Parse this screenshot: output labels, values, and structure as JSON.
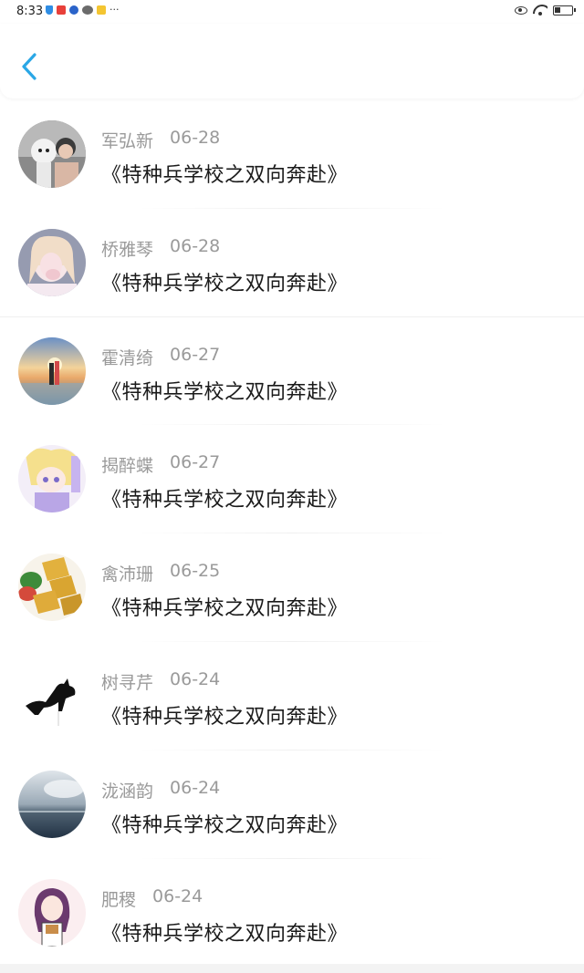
{
  "status_bar": {
    "time": "8:33",
    "more": "···"
  },
  "header": {
    "back_icon": "chevron-left-icon",
    "accent_color": "#2aa7e6"
  },
  "list": [
    {
      "name": "军弘新",
      "date": "06-28",
      "title": "《特种兵学校之双向奔赴》",
      "avatar": "avatar-robot-couple"
    },
    {
      "name": "桥雅琴",
      "date": "06-28",
      "title": "《特种兵学校之双向奔赴》",
      "avatar": "avatar-girl-selfie"
    },
    {
      "name": "霍清绮",
      "date": "06-27",
      "title": "《特种兵学校之双向奔赴》",
      "avatar": "avatar-beach-sunset"
    },
    {
      "name": "揭醉蝶",
      "date": "06-27",
      "title": "《特种兵学校之双向奔赴》",
      "avatar": "avatar-anime-girl"
    },
    {
      "name": "禽沛珊",
      "date": "06-25",
      "title": "《特种兵学校之双向奔赴》",
      "avatar": "avatar-cake-cubes"
    },
    {
      "name": "树寻芹",
      "date": "06-24",
      "title": "《特种兵学校之双向奔赴》",
      "avatar": "avatar-black-cat"
    },
    {
      "name": "泷涵韵",
      "date": "06-24",
      "title": "《特种兵学校之双向奔赴》",
      "avatar": "avatar-ocean-sky"
    },
    {
      "name": "肥稷",
      "date": "06-24",
      "title": "《特种兵学校之双向奔赴》",
      "avatar": "avatar-cartoon-girl"
    }
  ]
}
